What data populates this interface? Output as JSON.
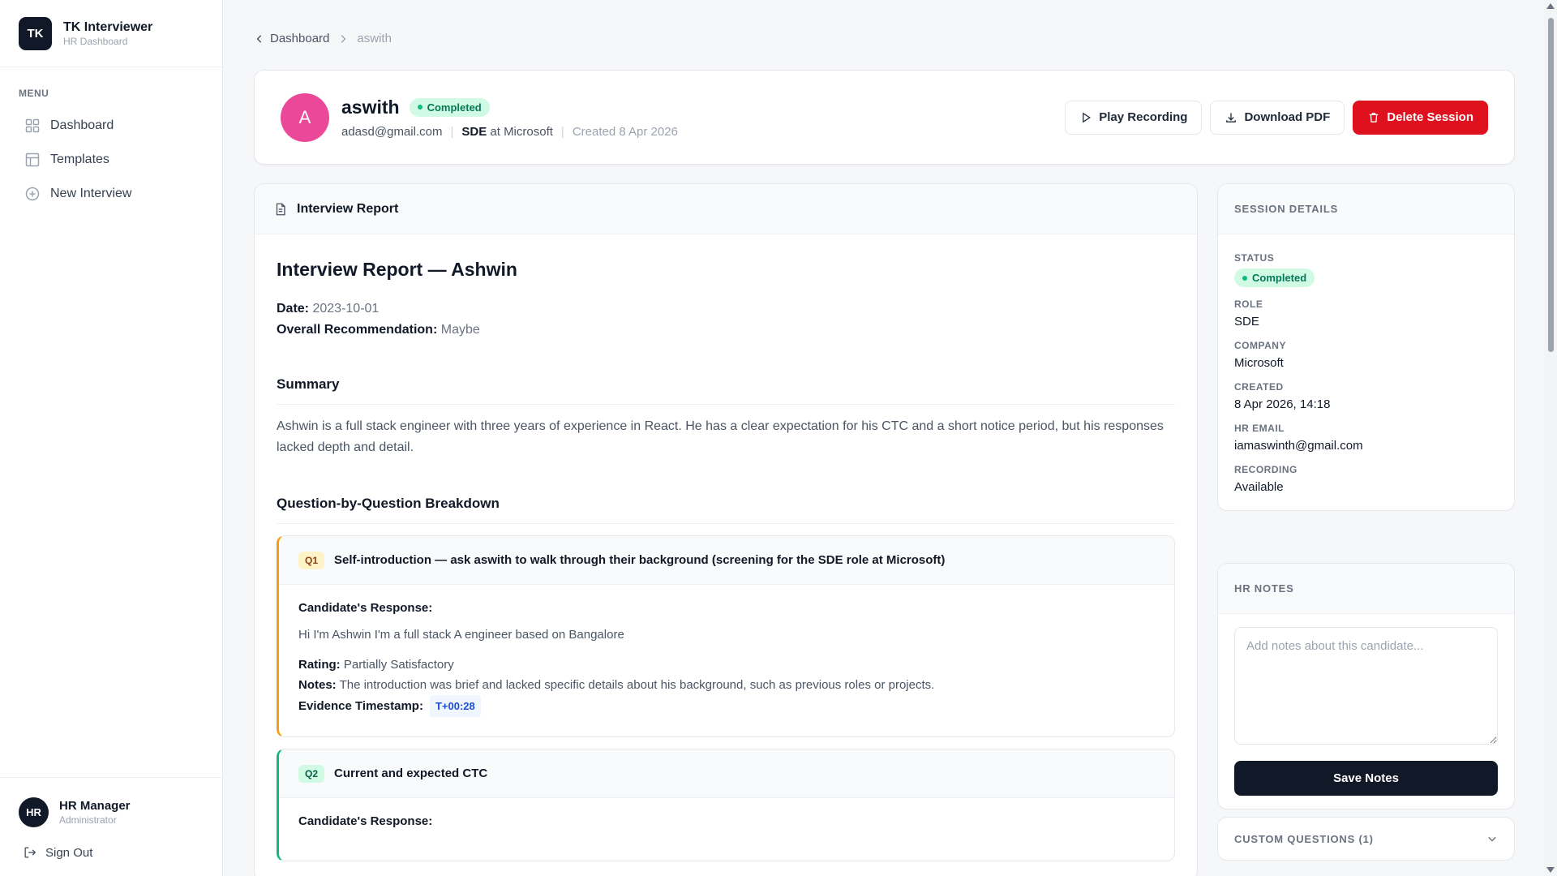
{
  "brand": {
    "logo": "TK",
    "title": "TK Interviewer",
    "subtitle": "HR Dashboard"
  },
  "menu": {
    "label": "MENU",
    "items": [
      {
        "label": "Dashboard",
        "icon": "grid-icon"
      },
      {
        "label": "Templates",
        "icon": "layout-icon"
      },
      {
        "label": "New Interview",
        "icon": "plus-circle-icon"
      }
    ]
  },
  "user": {
    "initials": "HR",
    "name": "HR Manager",
    "role": "Administrator",
    "signout": "Sign Out"
  },
  "breadcrumb": {
    "parent": "Dashboard",
    "current": "aswith"
  },
  "candidate": {
    "initial": "A",
    "name": "aswith",
    "status": "Completed",
    "email": "adasd@gmail.com",
    "role": "SDE",
    "at": "at",
    "company": "Microsoft",
    "created": "Created 8 Apr 2026"
  },
  "actions": {
    "play": "Play Recording",
    "download": "Download PDF",
    "delete": "Delete Session"
  },
  "report": {
    "header": "Interview Report",
    "title": "Interview Report — Ashwin",
    "date_label": "Date:",
    "date": "2023-10-01",
    "rec_label": "Overall Recommendation:",
    "rec": "Maybe",
    "summary_title": "Summary",
    "summary": "Ashwin is a full stack engineer with three years of experience in React. He has a clear expectation for his CTC and a short notice period, but his responses lacked depth and detail.",
    "breakdown_title": "Question-by-Question Breakdown",
    "questions": [
      {
        "tag": "Q1",
        "title": "Self-introduction — ask aswith to walk through their background (screening for the SDE role at Microsoft)",
        "response_label": "Candidate's Response:",
        "response": "Hi I'm Ashwin I'm a full stack A engineer based on Bangalore",
        "rating_label": "Rating:",
        "rating": "Partially Satisfactory",
        "notes_label": "Notes:",
        "notes": "The introduction was brief and lacked specific details about his background, such as previous roles or projects.",
        "ts_label": "Evidence Timestamp:",
        "ts": "T+00:28"
      },
      {
        "tag": "Q2",
        "title": "Current and expected CTC",
        "response_label": "Candidate's Response:"
      }
    ]
  },
  "session": {
    "header": "SESSION DETAILS",
    "status_label": "STATUS",
    "status": "Completed",
    "role_label": "ROLE",
    "role": "SDE",
    "company_label": "COMPANY",
    "company": "Microsoft",
    "created_label": "CREATED",
    "created": "8 Apr 2026, 14:18",
    "hr_email_label": "HR EMAIL",
    "hr_email": "iamaswinth@gmail.com",
    "recording_label": "RECORDING",
    "recording": "Available"
  },
  "hr_notes": {
    "header": "HR NOTES",
    "placeholder": "Add notes about this candidate...",
    "save": "Save Notes"
  },
  "custom_questions": {
    "label": "CUSTOM QUESTIONS (1)"
  }
}
